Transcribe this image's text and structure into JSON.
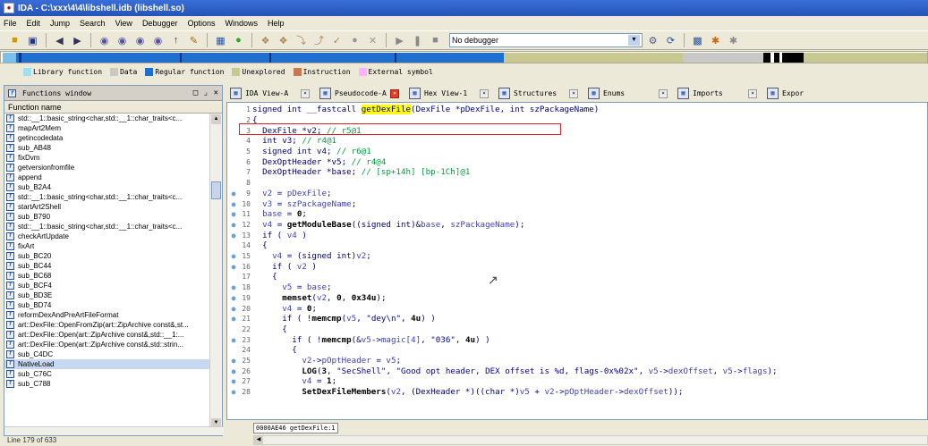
{
  "window": {
    "title": "IDA - C:\\xxx\\4\\4\\libshell.idb (libshell.so)"
  },
  "menu": [
    "File",
    "Edit",
    "Jump",
    "Search",
    "View",
    "Debugger",
    "Options",
    "Windows",
    "Help"
  ],
  "toolbar": {
    "debugger_select": "No debugger"
  },
  "legend": [
    {
      "label": "Library function",
      "color": "#a0e0f0"
    },
    {
      "label": "Data",
      "color": "#c8c8c8"
    },
    {
      "label": "Regular function",
      "color": "#1e6fd0"
    },
    {
      "label": "Unexplored",
      "color": "#c8c890"
    },
    {
      "label": "Instruction",
      "color": "#c87850"
    },
    {
      "label": "External symbol",
      "color": "#ffb0ff"
    }
  ],
  "functions_window": {
    "title": "Functions window",
    "column_header": "Function name",
    "items": [
      "std::__1::basic_string<char,std::__1::char_traits<c...",
      "mapArt2Mem",
      "getincodedata",
      "sub_AB48",
      "fixDvm",
      "getversionfromfile",
      "append",
      "sub_B2A4",
      "std::__1::basic_string<char,std::__1::char_traits<c...",
      "startArt2Shell",
      "sub_B790",
      "std::__1::basic_string<char,std::__1::char_traits<c...",
      "checkArtUpdate",
      "fixArt",
      "sub_BC20",
      "sub_BC44",
      "sub_BC68",
      "sub_BCF4",
      "sub_BD3E",
      "sub_BD74",
      "reformDexAndPreArtFileFormat",
      "art::DexFile::OpenFromZip(art::ZipArchive const&,st...",
      "art::DexFile::Open(art::ZipArchive const&,std::__1:...",
      "art::DexFile::Open(art::ZipArchive const&,std::strin...",
      "sub_C4DC",
      "NativeLoad",
      "sub_C76C",
      "sub_C788"
    ],
    "selected_index": 25,
    "status": "Line 179 of 633"
  },
  "tabs": [
    {
      "label": "IDA View-A",
      "icon": "ida-view-icon",
      "active": false
    },
    {
      "label": "Pseudocode-A",
      "icon": "pseudocode-icon",
      "active": true
    },
    {
      "label": "Hex View-1",
      "icon": "hex-view-icon",
      "active": false
    },
    {
      "label": "Structures",
      "icon": "structures-icon",
      "active": false
    },
    {
      "label": "Enums",
      "icon": "enums-icon",
      "active": false
    },
    {
      "label": "Imports",
      "icon": "imports-icon",
      "active": false
    },
    {
      "label": "Expor",
      "icon": "exports-icon",
      "active": false
    }
  ],
  "code_lines": [
    {
      "n": "1",
      "bp": false,
      "html": "signed int __fastcall <span class=\"hl-name\">getDexFile</span>(DexFile *pDexFile, int szPackageName)"
    },
    {
      "n": "2",
      "bp": false,
      "html": "{"
    },
    {
      "n": "3",
      "bp": false,
      "html": "  DexFile *v2; <span class=\"c-cmt\">// r5@1</span>"
    },
    {
      "n": "4",
      "bp": false,
      "html": "  int v3; <span class=\"c-cmt\">// r4@1</span>"
    },
    {
      "n": "5",
      "bp": false,
      "html": "  signed int v4; <span class=\"c-cmt\">// r6@1</span>"
    },
    {
      "n": "6",
      "bp": false,
      "html": "  DexOptHeader *v5; <span class=\"c-cmt\">// r4@4</span>"
    },
    {
      "n": "7",
      "bp": false,
      "html": "  DexOptHeader *base; <span class=\"c-cmt\">// [sp+14h] [bp-1Ch]@1</span>"
    },
    {
      "n": "8",
      "bp": false,
      "html": ""
    },
    {
      "n": "9",
      "bp": true,
      "html": "  <span class=\"c-var\">v2</span> = <span class=\"c-var\">pDexFile</span>;"
    },
    {
      "n": "10",
      "bp": true,
      "html": "  <span class=\"c-var\">v3</span> = <span class=\"c-var\">szPackageName</span>;"
    },
    {
      "n": "11",
      "bp": true,
      "html": "  <span class=\"c-var\">base</span> = <span class=\"c-fn\">0</span>;"
    },
    {
      "n": "12",
      "bp": true,
      "html": "  <span class=\"c-var\">v4</span> = <span class=\"c-fn\">getModuleBase</span>((signed int)&amp;<span class=\"c-var\">base</span>, <span class=\"c-var\">szPackageName</span>);"
    },
    {
      "n": "13",
      "bp": true,
      "html": "  if ( <span class=\"c-var\">v4</span> )"
    },
    {
      "n": "14",
      "bp": false,
      "html": "  {"
    },
    {
      "n": "15",
      "bp": true,
      "html": "    <span class=\"c-var\">v4</span> = (signed int)<span class=\"c-var\">v2</span>;"
    },
    {
      "n": "16",
      "bp": true,
      "html": "    if ( <span class=\"c-var\">v2</span> )"
    },
    {
      "n": "17",
      "bp": false,
      "html": "    {"
    },
    {
      "n": "18",
      "bp": true,
      "html": "      <span class=\"c-var\">v5</span> = <span class=\"c-var\">base</span>;"
    },
    {
      "n": "19",
      "bp": true,
      "html": "      <span class=\"c-fn\">memset</span>(<span class=\"c-var\">v2</span>, <span class=\"c-fn\">0</span>, <span class=\"c-fn\">0x34u</span>);"
    },
    {
      "n": "20",
      "bp": true,
      "html": "      <span class=\"c-var\">v4</span> = <span class=\"c-fn\">0</span>;"
    },
    {
      "n": "21",
      "bp": true,
      "html": "      if ( !<span class=\"c-fn\">memcmp</span>(<span class=\"c-var\">v5</span>, <span class=\"c-str\">\"dey\\n\"</span>, <span class=\"c-fn\">4u</span>) )"
    },
    {
      "n": "22",
      "bp": false,
      "html": "      {"
    },
    {
      "n": "23",
      "bp": true,
      "html": "        if ( !<span class=\"c-fn\">memcmp</span>(&amp;<span class=\"c-var\">v5</span>-&gt;<span class=\"c-var\">magic[4]</span>, <span class=\"c-str\">\"036\"</span>, <span class=\"c-fn\">4u</span>) )"
    },
    {
      "n": "24",
      "bp": false,
      "html": "        {"
    },
    {
      "n": "25",
      "bp": true,
      "html": "          <span class=\"c-var\">v2</span>-&gt;<span class=\"c-var\">pOptHeader</span> = <span class=\"c-var\">v5</span>;"
    },
    {
      "n": "26",
      "bp": true,
      "html": "          <span class=\"c-fn\">LOG</span>(<span class=\"c-fn\">3</span>, <span class=\"c-str\">\"SecShell\"</span>, <span class=\"c-str\">\"Good opt header, DEX offset is %d, flags-0x%02x\"</span>, <span class=\"c-var\">v5</span>-&gt;<span class=\"c-var\">dexOffset</span>, <span class=\"c-var\">v5</span>-&gt;<span class=\"c-var\">flags</span>);"
    },
    {
      "n": "27",
      "bp": true,
      "html": "          <span class=\"c-var\">v4</span> = <span class=\"c-fn\">1</span>;"
    },
    {
      "n": "28",
      "bp": true,
      "html": "          <span class=\"c-fn\">SetDexFileMembers</span>(<span class=\"c-var\">v2</span>, (DexHeader *)((char *)<span class=\"c-var\">v5</span> + <span class=\"c-var\">v2</span>-&gt;<span class=\"c-var\">pOptHeader</span>-&gt;<span class=\"c-var\">dexOffset</span>));"
    }
  ],
  "code_status": "0000AE46 getDexFile:1"
}
